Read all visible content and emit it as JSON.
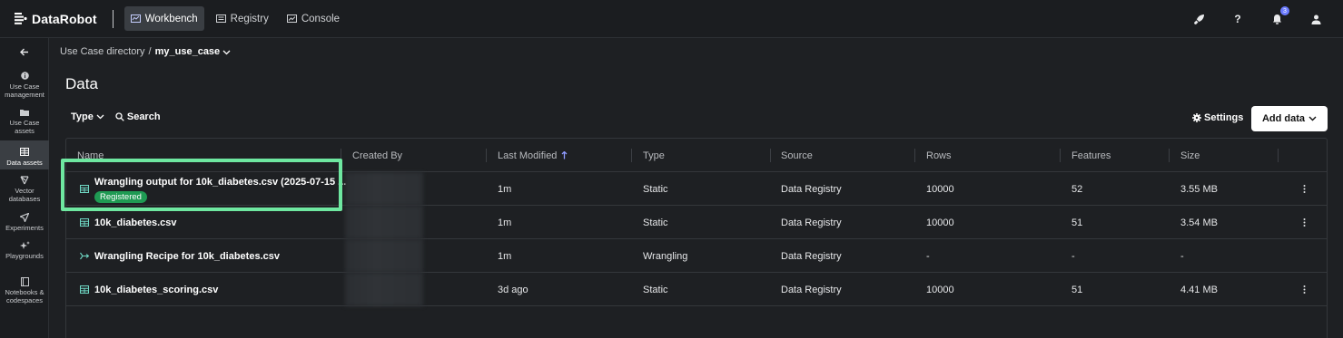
{
  "app": {
    "logo_text": "DataRobot",
    "nav": [
      {
        "label": "Workbench",
        "active": true
      },
      {
        "label": "Registry",
        "active": false
      },
      {
        "label": "Console",
        "active": false
      }
    ],
    "notification_count": "3"
  },
  "sidebar": {
    "items": [
      {
        "label": "Use Case management",
        "icon": "info-icon"
      },
      {
        "label": "Use Case assets",
        "icon": "folder-icon"
      },
      {
        "label": "Data assets",
        "icon": "table-icon",
        "active": true
      },
      {
        "label": "Vector databases",
        "icon": "vector-icon"
      },
      {
        "label": "Experiments",
        "icon": "send-icon"
      },
      {
        "label": "Playgrounds",
        "icon": "sparkle-icon"
      },
      {
        "label": "Notebooks & codespaces",
        "icon": "notebook-icon"
      }
    ]
  },
  "breadcrumb": {
    "parent": "Use Case directory",
    "separator": "/",
    "current": "my_use_case"
  },
  "page": {
    "title": "Data",
    "filter_type": "Type",
    "search": "Search",
    "settings": "Settings",
    "add_data": "Add data"
  },
  "table": {
    "columns": [
      "Name",
      "Created By",
      "Last Modified",
      "Type",
      "Source",
      "Rows",
      "Features",
      "Size"
    ],
    "rows": [
      {
        "name": "Wrangling output for 10k_diabetes.csv (2025-07-15 ...",
        "badge": "Registered",
        "modified": "1m",
        "type": "Static",
        "source": "Data Registry",
        "rows": "10000",
        "features": "52",
        "size": "3.55 MB",
        "icon": "table-icon"
      },
      {
        "name": "10k_diabetes.csv",
        "modified": "1m",
        "type": "Static",
        "source": "Data Registry",
        "rows": "10000",
        "features": "51",
        "size": "3.54 MB",
        "icon": "table-icon"
      },
      {
        "name": "Wrangling Recipe for 10k_diabetes.csv",
        "modified": "1m",
        "type": "Wrangling",
        "source": "Data Registry",
        "rows": "-",
        "features": "-",
        "size": "-",
        "icon": "recipe-icon"
      },
      {
        "name": "10k_diabetes_scoring.csv",
        "modified": "3d ago",
        "type": "Static",
        "source": "Data Registry",
        "rows": "10000",
        "features": "51",
        "size": "4.41 MB",
        "icon": "table-icon"
      }
    ]
  },
  "colors": {
    "background": "#1e2023",
    "highlight": "#6ee7a0",
    "registered_badge": "#1f9a53",
    "accent": "#6b7bff"
  }
}
